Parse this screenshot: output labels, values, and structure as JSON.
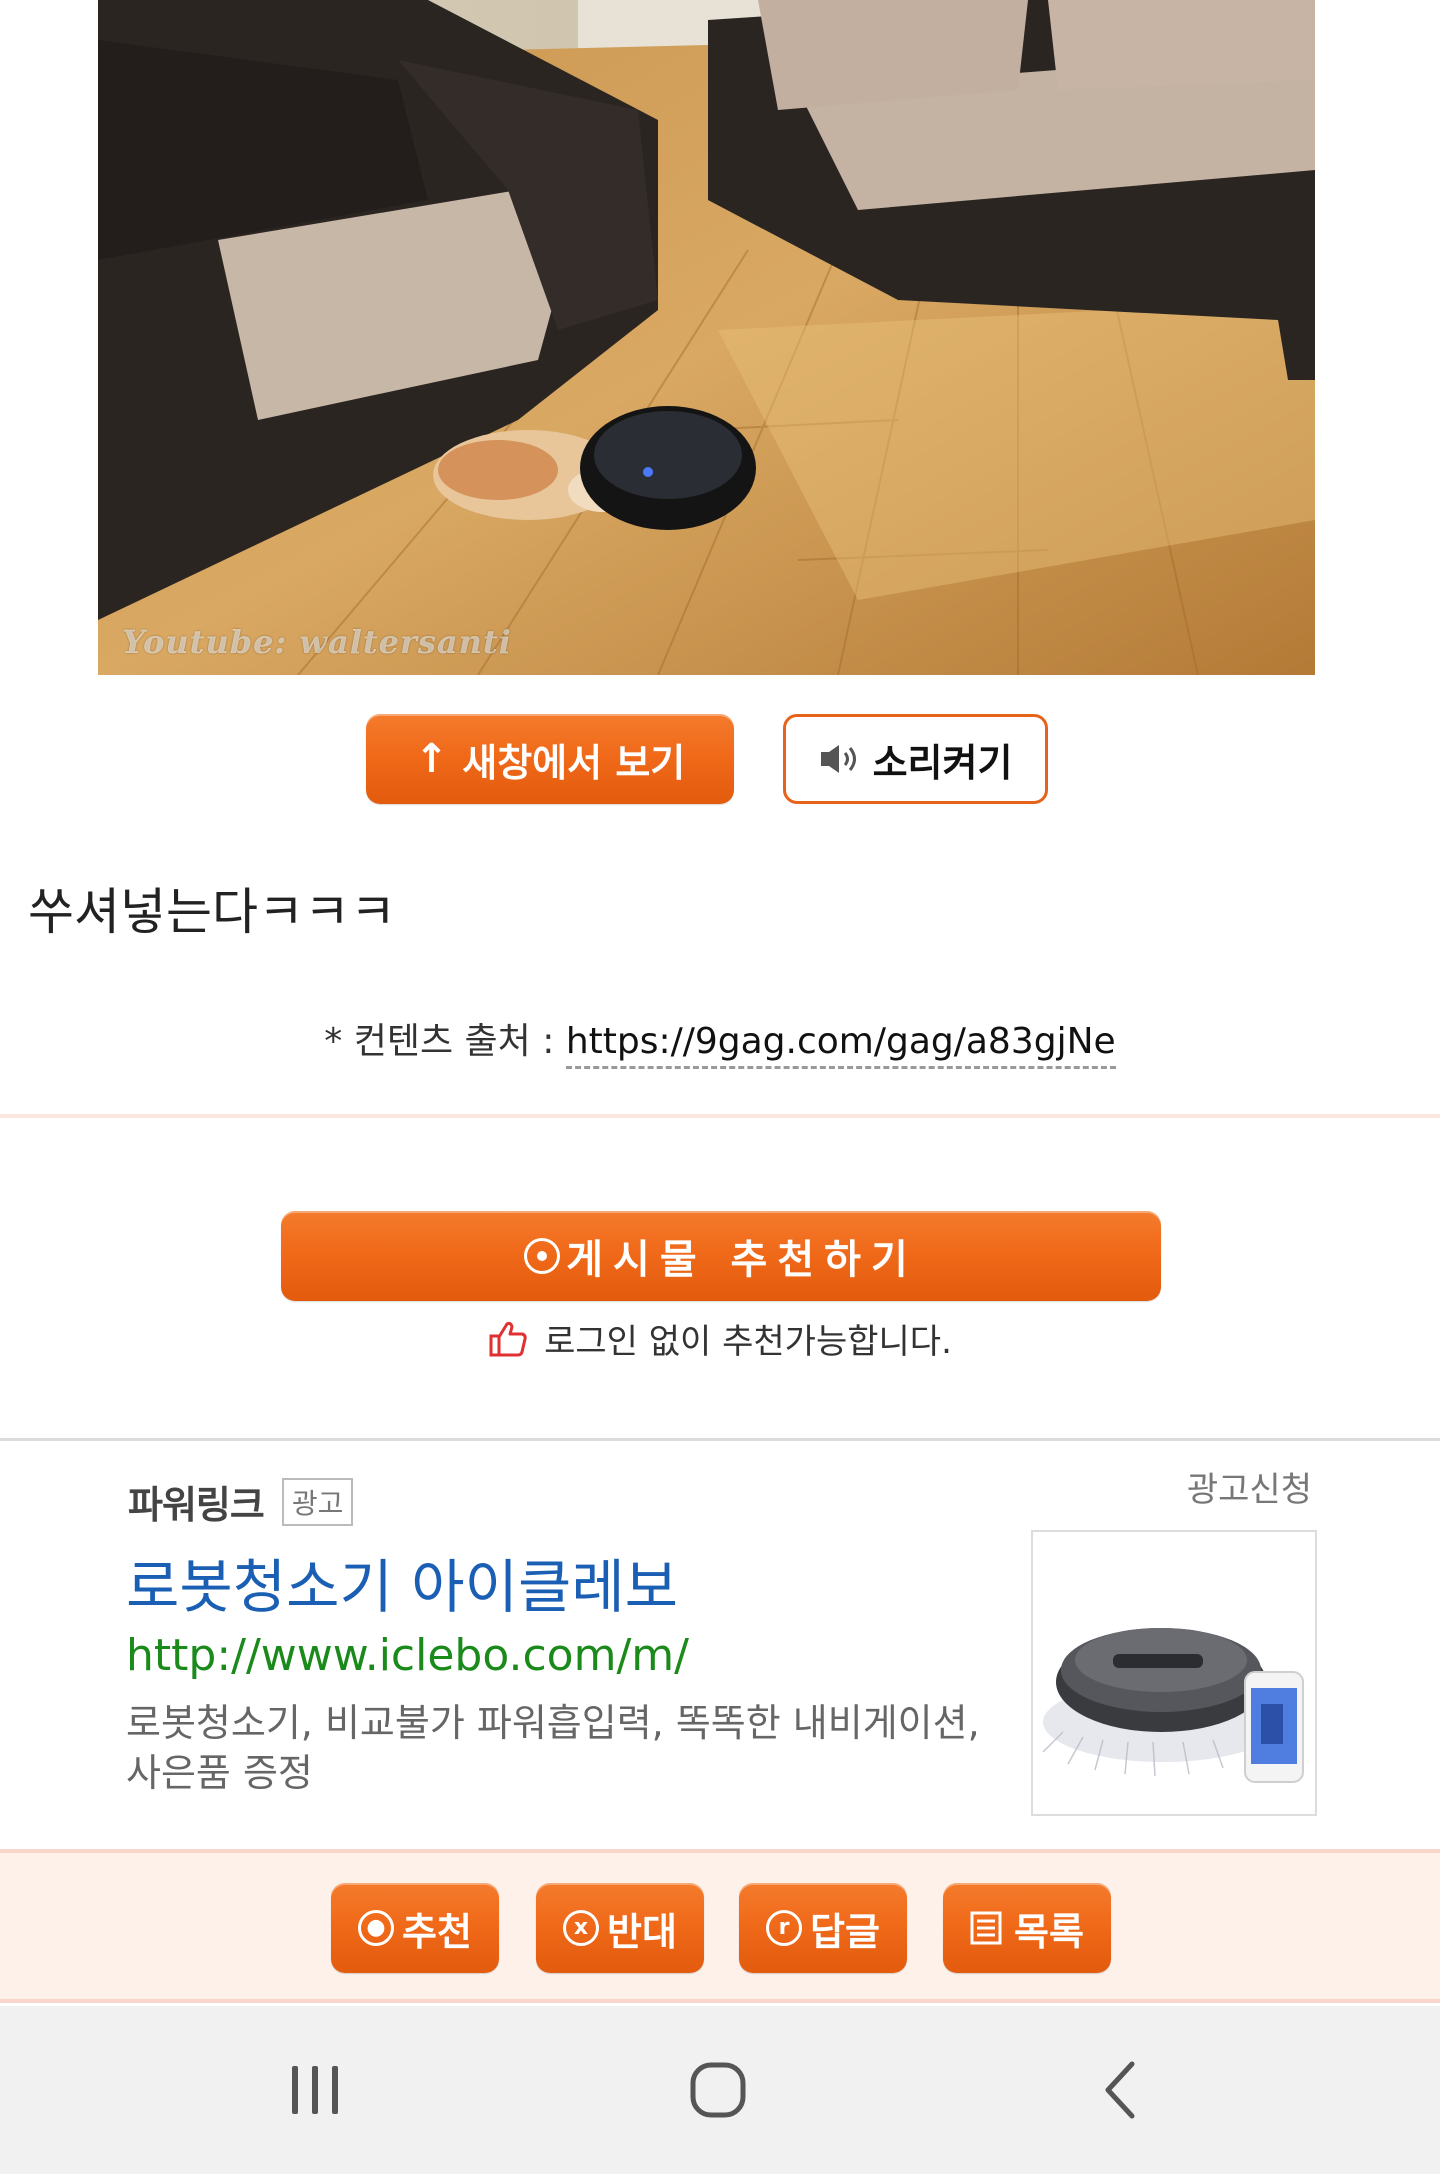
{
  "video": {
    "watermark": "Youtube: waltersanti"
  },
  "buttons": {
    "new_window": "새창에서 보기",
    "sound_on": "소리켜기"
  },
  "post": {
    "text": "쑤셔넣는다ㅋㅋㅋ"
  },
  "source": {
    "label": "* 컨텐츠 출처 :",
    "url": "https://9gag.com/gag/a83gjNe"
  },
  "recommend": {
    "button_label": "게시물 추천하기",
    "note": "로그인 없이 추천가능합니다."
  },
  "ad": {
    "powerlink": "파워링크",
    "badge": "광고",
    "apply": "광고신청",
    "title": "로봇청소기 아이클레보",
    "url": "http://www.iclebo.com/m/",
    "description": "로봇청소기, 비교불가 파워흡입력, 똑똑한 내비게이션, 사은품 증정"
  },
  "actions": {
    "recommend": "추천",
    "oppose": "반대",
    "reply": "답글",
    "list": "목록"
  },
  "colors": {
    "accent_orange": "#f06a1a",
    "ad_title_blue": "#1a5fb4",
    "ad_url_green": "#1a8a1a",
    "action_bar_bg": "#fdf1ea"
  }
}
